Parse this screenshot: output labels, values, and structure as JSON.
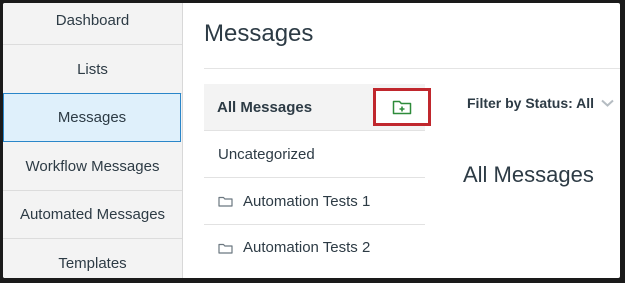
{
  "sidebar": {
    "items": [
      {
        "label": "Dashboard"
      },
      {
        "label": "Lists"
      },
      {
        "label": "Messages"
      },
      {
        "label": "Workflow Messages"
      },
      {
        "label": "Automated Messages"
      },
      {
        "label": "Templates"
      }
    ],
    "active_index": 2
  },
  "main": {
    "title": "Messages",
    "folders": [
      {
        "label": "All Messages"
      },
      {
        "label": "Uncategorized"
      },
      {
        "label": "Automation Tests 1"
      },
      {
        "label": "Automation Tests 2"
      }
    ],
    "new_folder_icon": "folder-plus-icon",
    "filter": {
      "label": "Filter by Status: All",
      "icon": "chevron-down-icon"
    },
    "detail_title": "All Messages"
  },
  "colors": {
    "accent": "#2a86c9",
    "active_bg": "#dff0fb",
    "highlight_border": "#c0272d",
    "icon_green": "#2e8b3a",
    "text": "#2d3b45"
  }
}
